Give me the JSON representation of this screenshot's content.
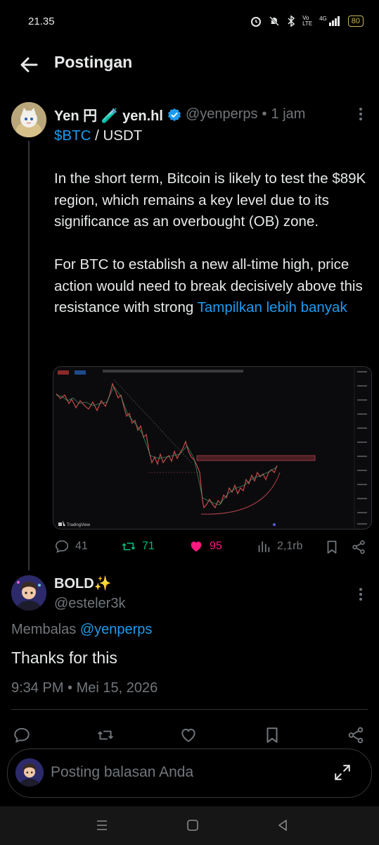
{
  "status_bar": {
    "time": "21.35",
    "network": "4G",
    "volte": "Vo LTE",
    "battery": "80"
  },
  "header": {
    "title": "Postingan"
  },
  "post": {
    "author_name": "Yen 円 🧪 yen.hl",
    "handle": "@yenperps",
    "separator": "•",
    "time": "1 jam",
    "cashtag": "$BTC",
    "pair_suffix": " / USDT",
    "para1": "In the short term, Bitcoin is likely to test the $89K region, which remains a key level due to its significance as an overbought (OB) zone.",
    "para2_start": "For BTC to establish a new all-time high, price action would need to break decisively above this resistance with strong ",
    "show_more": "Tampilkan lebih banyak",
    "chart_brand": "TradingView",
    "stats": {
      "replies": "41",
      "reposts": "71",
      "likes": "95",
      "views": "2,1rb"
    }
  },
  "reply": {
    "author_name": "BOLD✨",
    "handle": "@esteler3k",
    "replying_prefix": "Membalas ",
    "replying_to": "@yenperps",
    "text": "Thanks for this",
    "timestamp": "9:34 PM • Mei 15, 2026"
  },
  "composer": {
    "placeholder": "Posting balasan Anda"
  },
  "colors": {
    "accent": "#1d9bf0",
    "repost_active": "#00ba7c",
    "like_active": "#f91880",
    "muted": "#71767b",
    "background": "#000000"
  },
  "icons": {
    "back": "arrow-left-icon",
    "more": "more-vertical-icon",
    "verified": "verified-badge-icon",
    "reply": "comment-icon",
    "repost": "repost-icon",
    "like": "heart-icon",
    "views": "bar-chart-icon",
    "bookmark": "bookmark-icon",
    "share": "share-icon",
    "expand": "expand-icon"
  }
}
